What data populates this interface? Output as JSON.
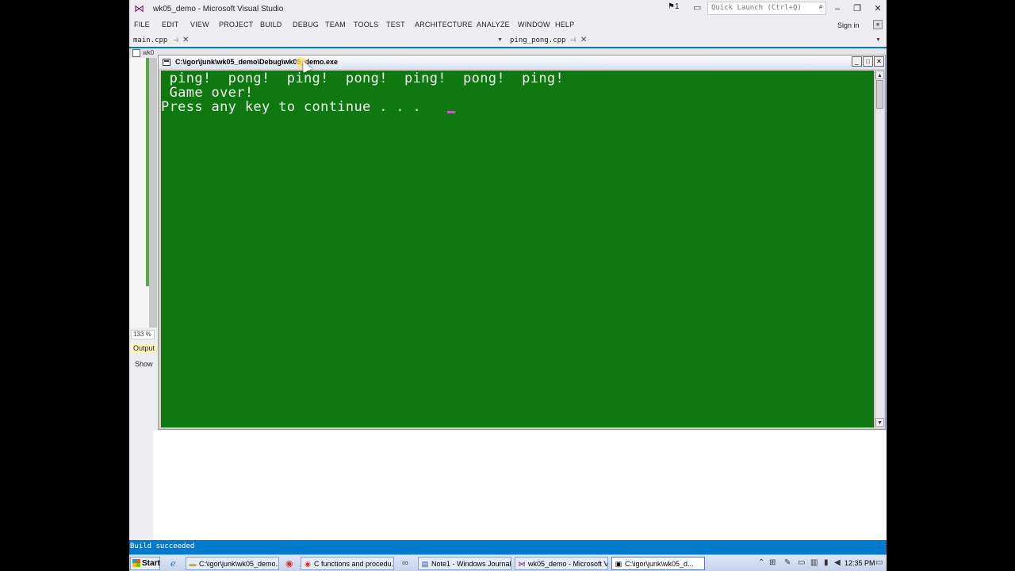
{
  "vs": {
    "title": "wk05_demo - Microsoft Visual Studio",
    "notification_count": "1",
    "quick_launch_placeholder": "Quick Launch (Ctrl+Q)",
    "sign_in": "Sign in",
    "menu": [
      "FILE",
      "EDIT",
      "VIEW",
      "PROJECT",
      "BUILD",
      "DEBUG",
      "TEAM",
      "TOOLS",
      "TEST",
      "ARCHITECTURE",
      "ANALYZE",
      "WINDOW",
      "HELP"
    ],
    "tabs": [
      {
        "label": "main.cpp"
      },
      {
        "label": "ping_pong.cpp"
      }
    ],
    "nav_label": "wk0",
    "zoom": "133 %",
    "output_label": "Output",
    "show_label": "Show",
    "status": "Build succeeded",
    "accent_color": "#007acc"
  },
  "console": {
    "title": "C:\\igor\\junk\\wk05_demo\\Debug\\wk05_demo.exe",
    "lines": [
      " ping!  pong!  ping!  pong!  ping!  pong!  ping!",
      " Game over!",
      "Press any key to continue . . . "
    ],
    "background_color": "#107810"
  },
  "taskbar": {
    "start": "Start",
    "tasks": [
      {
        "label": "C:\\igor\\junk\\wk05_demo..."
      },
      {
        "label": "C functions and procedu..."
      },
      {
        "label": "Note1 - Windows Journal"
      },
      {
        "label": "wk05_demo - Microsoft V..."
      },
      {
        "label": "C:\\igor\\junk\\wk05_d..."
      }
    ],
    "clock": "12:35 PM"
  }
}
